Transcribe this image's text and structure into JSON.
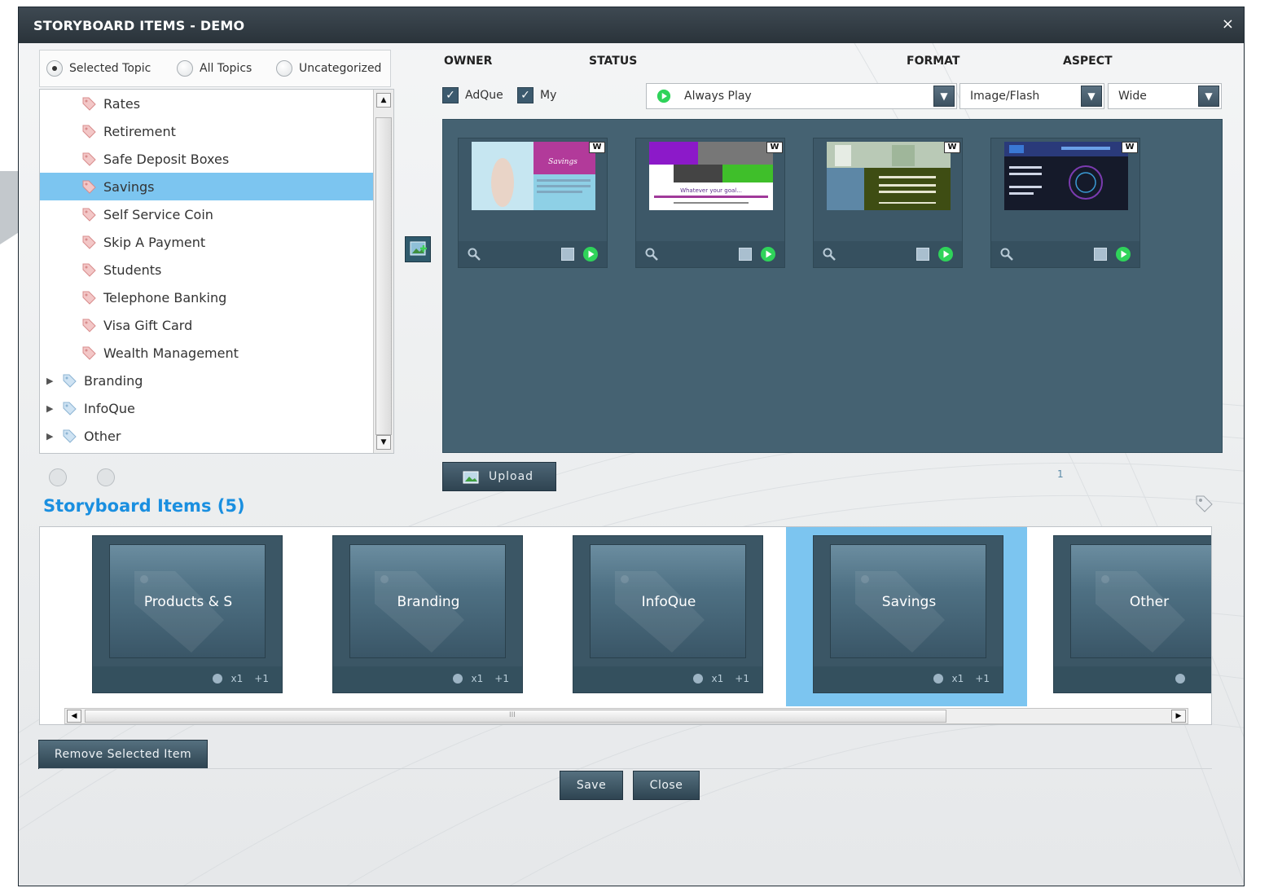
{
  "dialog": {
    "title": "STORYBOARD ITEMS - DEMO",
    "close_glyph": "×"
  },
  "topic_filter": {
    "options": [
      {
        "label": "Selected Topic",
        "selected": true
      },
      {
        "label": "All Topics",
        "selected": false
      },
      {
        "label": "Uncategorized",
        "selected": false
      }
    ]
  },
  "tree": {
    "items": [
      {
        "label": "Rates",
        "level": 1,
        "selected": false
      },
      {
        "label": "Retirement",
        "level": 1,
        "selected": false
      },
      {
        "label": "Safe Deposit Boxes",
        "level": 1,
        "selected": false
      },
      {
        "label": "Savings",
        "level": 1,
        "selected": true
      },
      {
        "label": "Self Service Coin",
        "level": 1,
        "selected": false
      },
      {
        "label": "Skip A Payment",
        "level": 1,
        "selected": false
      },
      {
        "label": "Students",
        "level": 1,
        "selected": false
      },
      {
        "label": "Telephone Banking",
        "level": 1,
        "selected": false
      },
      {
        "label": "Visa Gift Card",
        "level": 1,
        "selected": false
      },
      {
        "label": "Wealth Management",
        "level": 1,
        "selected": false
      },
      {
        "label": "Branding",
        "level": 0,
        "selected": false
      },
      {
        "label": "InfoQue",
        "level": 0,
        "selected": false
      },
      {
        "label": "Other",
        "level": 0,
        "selected": false
      }
    ]
  },
  "filters": {
    "owner_label": "OWNER",
    "status_label": "STATUS",
    "format_label": "FORMAT",
    "aspect_label": "ASPECT",
    "owner_checks": [
      {
        "label": "AdQue",
        "checked": true
      },
      {
        "label": "My",
        "checked": true
      }
    ],
    "status_value": "Always Play",
    "format_value": "Image/Flash",
    "aspect_value": "Wide"
  },
  "media_grid": {
    "items": [
      {
        "badge": "W",
        "thumb_text": "Savings"
      },
      {
        "badge": "W",
        "thumb_text": "Whatever your goal..."
      },
      {
        "badge": "W",
        "thumb_text": ""
      },
      {
        "badge": "W",
        "thumb_text": ""
      }
    ],
    "upload_label": "Upload",
    "page_number": "1"
  },
  "storyboard": {
    "title": "Storyboard Items (5)",
    "items": [
      {
        "label": "Products & S",
        "count": "x1",
        "delta": "+1",
        "selected": false
      },
      {
        "label": "Branding",
        "count": "x1",
        "delta": "+1",
        "selected": false
      },
      {
        "label": "InfoQue",
        "count": "x1",
        "delta": "+1",
        "selected": false
      },
      {
        "label": "Savings",
        "count": "x1",
        "delta": "+1",
        "selected": true
      },
      {
        "label": "Other",
        "count": "",
        "delta": "",
        "selected": false
      }
    ],
    "scroll_grip": "III"
  },
  "actions": {
    "remove_label": "Remove Selected Item",
    "save_label": "Save",
    "close_label": "Close"
  },
  "colors": {
    "accent": "#1a8fe0",
    "selection": "#7cc5f0",
    "panel": "#456272",
    "play_green": "#2fd35a"
  }
}
